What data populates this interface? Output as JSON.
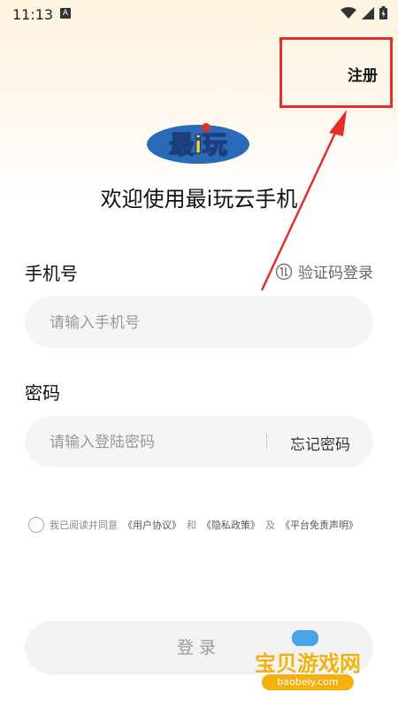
{
  "status_bar": {
    "time": "11:13",
    "notification_icon": "A"
  },
  "header": {
    "register_label": "注册"
  },
  "logo": {
    "text": "最i玩"
  },
  "welcome": {
    "title": "欢迎使用最i玩云手机"
  },
  "phone": {
    "label": "手机号",
    "placeholder": "请输入手机号",
    "alt_login_label": "验证码登录"
  },
  "password": {
    "label": "密码",
    "placeholder": "请输入登陆密码",
    "forgot_label": "忘记密码"
  },
  "agreement": {
    "prefix": "我已阅读并同意",
    "user_agreement": "《用户协议》",
    "and1": "和",
    "privacy_policy": "《隐私政策》",
    "and2": "及",
    "disclaimer": "《平台免责声明》"
  },
  "login": {
    "label": "登录"
  },
  "watermark": {
    "title": "宝贝游戏网",
    "url": "baobeiy.com"
  },
  "colors": {
    "accent_red": "#e0302c",
    "watermark_yellow": "#f3b10f"
  }
}
